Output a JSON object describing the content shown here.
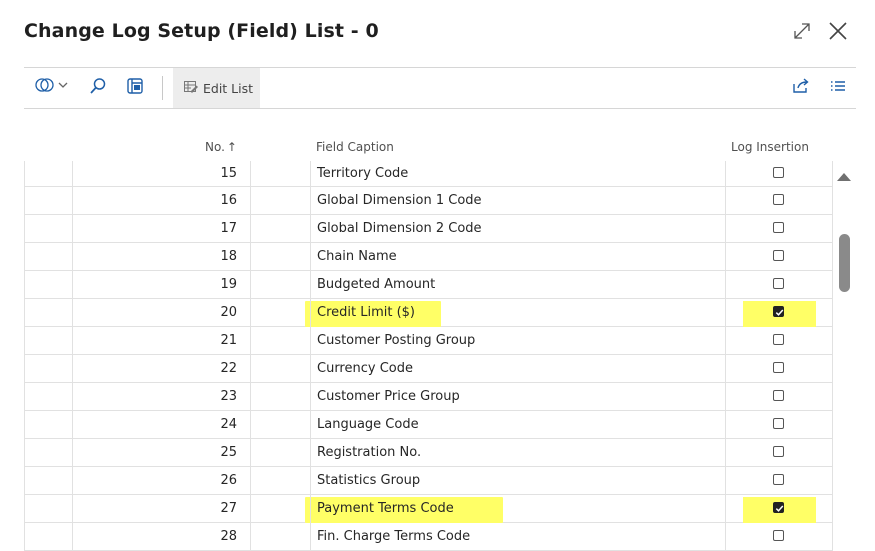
{
  "window": {
    "title": "Change Log Setup (Field) List - 0"
  },
  "toolbar": {
    "edit_list_label": "Edit List"
  },
  "columns": {
    "no": "No.",
    "sort_indicator": "↑",
    "field_caption": "Field Caption",
    "log_insertion": "Log Insertion"
  },
  "rows": [
    {
      "no": "15",
      "caption": "Territory Code",
      "log_insertion": false,
      "highlighted": false
    },
    {
      "no": "16",
      "caption": "Global Dimension 1 Code",
      "log_insertion": false,
      "highlighted": false
    },
    {
      "no": "17",
      "caption": "Global Dimension 2 Code",
      "log_insertion": false,
      "highlighted": false
    },
    {
      "no": "18",
      "caption": "Chain Name",
      "log_insertion": false,
      "highlighted": false
    },
    {
      "no": "19",
      "caption": "Budgeted Amount",
      "log_insertion": false,
      "highlighted": false
    },
    {
      "no": "20",
      "caption": "Credit Limit ($)",
      "log_insertion": true,
      "highlighted": true
    },
    {
      "no": "21",
      "caption": "Customer Posting Group",
      "log_insertion": false,
      "highlighted": false
    },
    {
      "no": "22",
      "caption": "Currency Code",
      "log_insertion": false,
      "highlighted": false
    },
    {
      "no": "23",
      "caption": "Customer Price Group",
      "log_insertion": false,
      "highlighted": false
    },
    {
      "no": "24",
      "caption": "Language Code",
      "log_insertion": false,
      "highlighted": false
    },
    {
      "no": "25",
      "caption": "Registration No.",
      "log_insertion": false,
      "highlighted": false
    },
    {
      "no": "26",
      "caption": "Statistics Group",
      "log_insertion": false,
      "highlighted": false
    },
    {
      "no": "27",
      "caption": "Payment Terms Code",
      "log_insertion": true,
      "highlighted": true
    },
    {
      "no": "28",
      "caption": "Fin. Charge Terms Code",
      "log_insertion": false,
      "highlighted": false
    }
  ],
  "colors": {
    "highlight": "#ffff66",
    "accent": "#1f5fa8"
  },
  "icons": {
    "toolbar": [
      "filter-pane-icon",
      "search-icon",
      "list-view-icon",
      "edit-list-icon",
      "share-icon",
      "column-list-icon"
    ],
    "window": [
      "expand-icon",
      "close-icon"
    ]
  }
}
